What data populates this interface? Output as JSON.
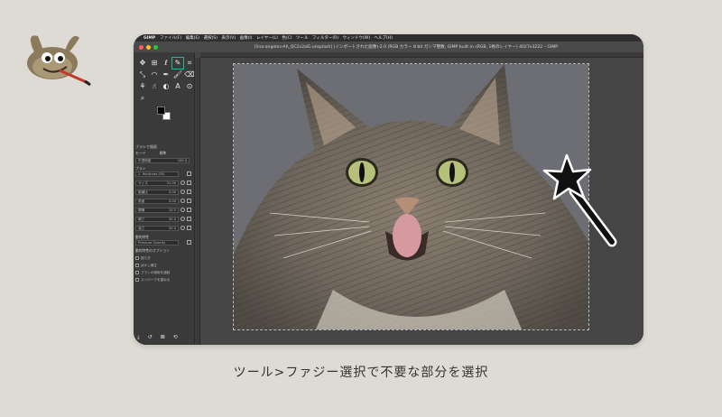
{
  "menubar": {
    "app": "GIMP",
    "items": [
      "ファイル(F)",
      "編集(E)",
      "選択(S)",
      "表示(V)",
      "画像(I)",
      "レイヤー(L)",
      "色(C)",
      "ツール",
      "フィルター(R)",
      "ウィンドウ(W)",
      "ヘルプ(H)"
    ]
  },
  "titlebar": {
    "title": "[lina-angelov-Ah_QC2v2alE-unsplash] (インポートされた画像)-2.0 (RGB カラー 8 bit ガンマ整数, GIMP built-in sRGB, 1枚のレイヤー) 4027x3222 – GIMP"
  },
  "tool_options": {
    "title": "ブラシで描画",
    "mode_label": "モード",
    "mode_value": "標準",
    "opacity_label": "不透明度",
    "opacity_value": "100.0",
    "brush_label": "ブラシ",
    "brush_name": "2. Hardness 050",
    "sliders": [
      {
        "label": "サイズ",
        "value": "51.00"
      },
      {
        "label": "縦横比",
        "value": "0.00"
      },
      {
        "label": "角度",
        "value": "0.00"
      },
      {
        "label": "間隔",
        "value": "10.0"
      },
      {
        "label": "硬さ",
        "value": "50.0"
      },
      {
        "label": "強さ",
        "value": "50.0"
      }
    ],
    "dynamics_label": "動的特性",
    "dynamics_value": "Pressure Opacity",
    "dynamics_options": "動的特性のオプション",
    "checks": [
      "揺らぎ",
      "ぼかし補正",
      "ブラシの適用を強制",
      "ストロークを重ねる"
    ]
  },
  "caption": "ツール>ファジー選択で不要な部分を選択",
  "icons": {
    "logo": "gimp-wilber-icon",
    "wand": "fuzzy-select-wand-icon"
  },
  "colors": {
    "accent": "#2bb39a",
    "window_bg": "#3c3c3c",
    "page_bg": "#dddbd3"
  }
}
